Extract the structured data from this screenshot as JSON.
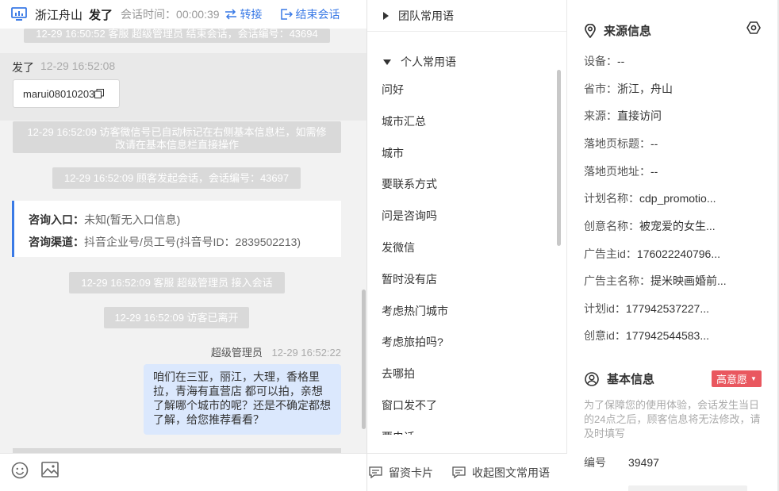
{
  "header": {
    "location": "浙江舟山",
    "visitor_name": "发了",
    "session_time_label": "会话时间：00:00:39",
    "transfer_label": "转接",
    "end_session_label": "结束会话"
  },
  "chat": {
    "cut_top_text": "12-29 16:50:52 客服 超级管理员 结束会话，会话编号：43694",
    "visitor_name": "发了",
    "visitor_time": "12-29 16:52:08",
    "visitor_message": "marui08010203",
    "system_messages": [
      "12-29 16:52:09 访客微信号已自动标记在右侧基本信息栏，如需修改请在基本信息栏直接操作",
      "12-29 16:52:09 顾客发起会话，会话编号：43697",
      "12-29 16:52:09 客服 超级管理员 接入会话",
      "12-29 16:52:09 访客已离开"
    ],
    "source_card": {
      "entry_label": "咨询入口：",
      "entry_value": "未知(暂无入口信息)",
      "channel_label": "咨询渠道：",
      "channel_value": "抖音企业号/员工号(抖音号ID：2839502213)"
    },
    "agent_name": "超级管理员",
    "agent_time": "12-29 16:52:22",
    "agent_message": "咱们在三亚，丽江，大理，香格里拉，青海有直营店 都可以拍，亲想了解哪个城市的呢？还是不确定都想了解，给您推荐看看？"
  },
  "phrases": {
    "team_group": "团队常用语",
    "personal_group": "个人常用语",
    "items": [
      "问好",
      "城市汇总",
      "城市",
      "要联系方式",
      "问是咨询吗",
      "发微信",
      "暂时没有店",
      "考虑热门城市",
      "考虑旅拍吗?",
      "去哪拍",
      "窗口发不了",
      "要电话"
    ],
    "card_button": "留资卡片",
    "collapse_button": "收起图文常用语"
  },
  "info": {
    "source_title": "来源信息",
    "source_rows": [
      {
        "key": "设备：",
        "value": "--"
      },
      {
        "key": "省市：",
        "value": "浙江，舟山"
      },
      {
        "key": "来源：",
        "value": "直接访问"
      },
      {
        "key": "落地页标题：",
        "value": "--"
      },
      {
        "key": "落地页地址：",
        "value": "--"
      },
      {
        "key": "计划名称：",
        "value": "cdp_promotio..."
      },
      {
        "key": "创意名称：",
        "value": "被宠爱的女生..."
      },
      {
        "key": "广告主id：",
        "value": "176022240796..."
      },
      {
        "key": "广告主名称：",
        "value": "提米映画婚前..."
      },
      {
        "key": "计划id：",
        "value": "177942537227..."
      },
      {
        "key": "创意id：",
        "value": "177942544583..."
      }
    ],
    "basic_title": "基本信息",
    "intent_badge": "高意愿",
    "basic_note": "为了保障您的使用体验，会话发生当日的24点之后，顾客信息将无法修改，请及时填写",
    "id_label": "编号",
    "id_value": "39497"
  },
  "colors": {
    "accent": "#3a7ae6",
    "agent_bubble": "#dbe8fd",
    "system_msg": "#d9d9d9",
    "intent_badge": "#e9575f"
  }
}
